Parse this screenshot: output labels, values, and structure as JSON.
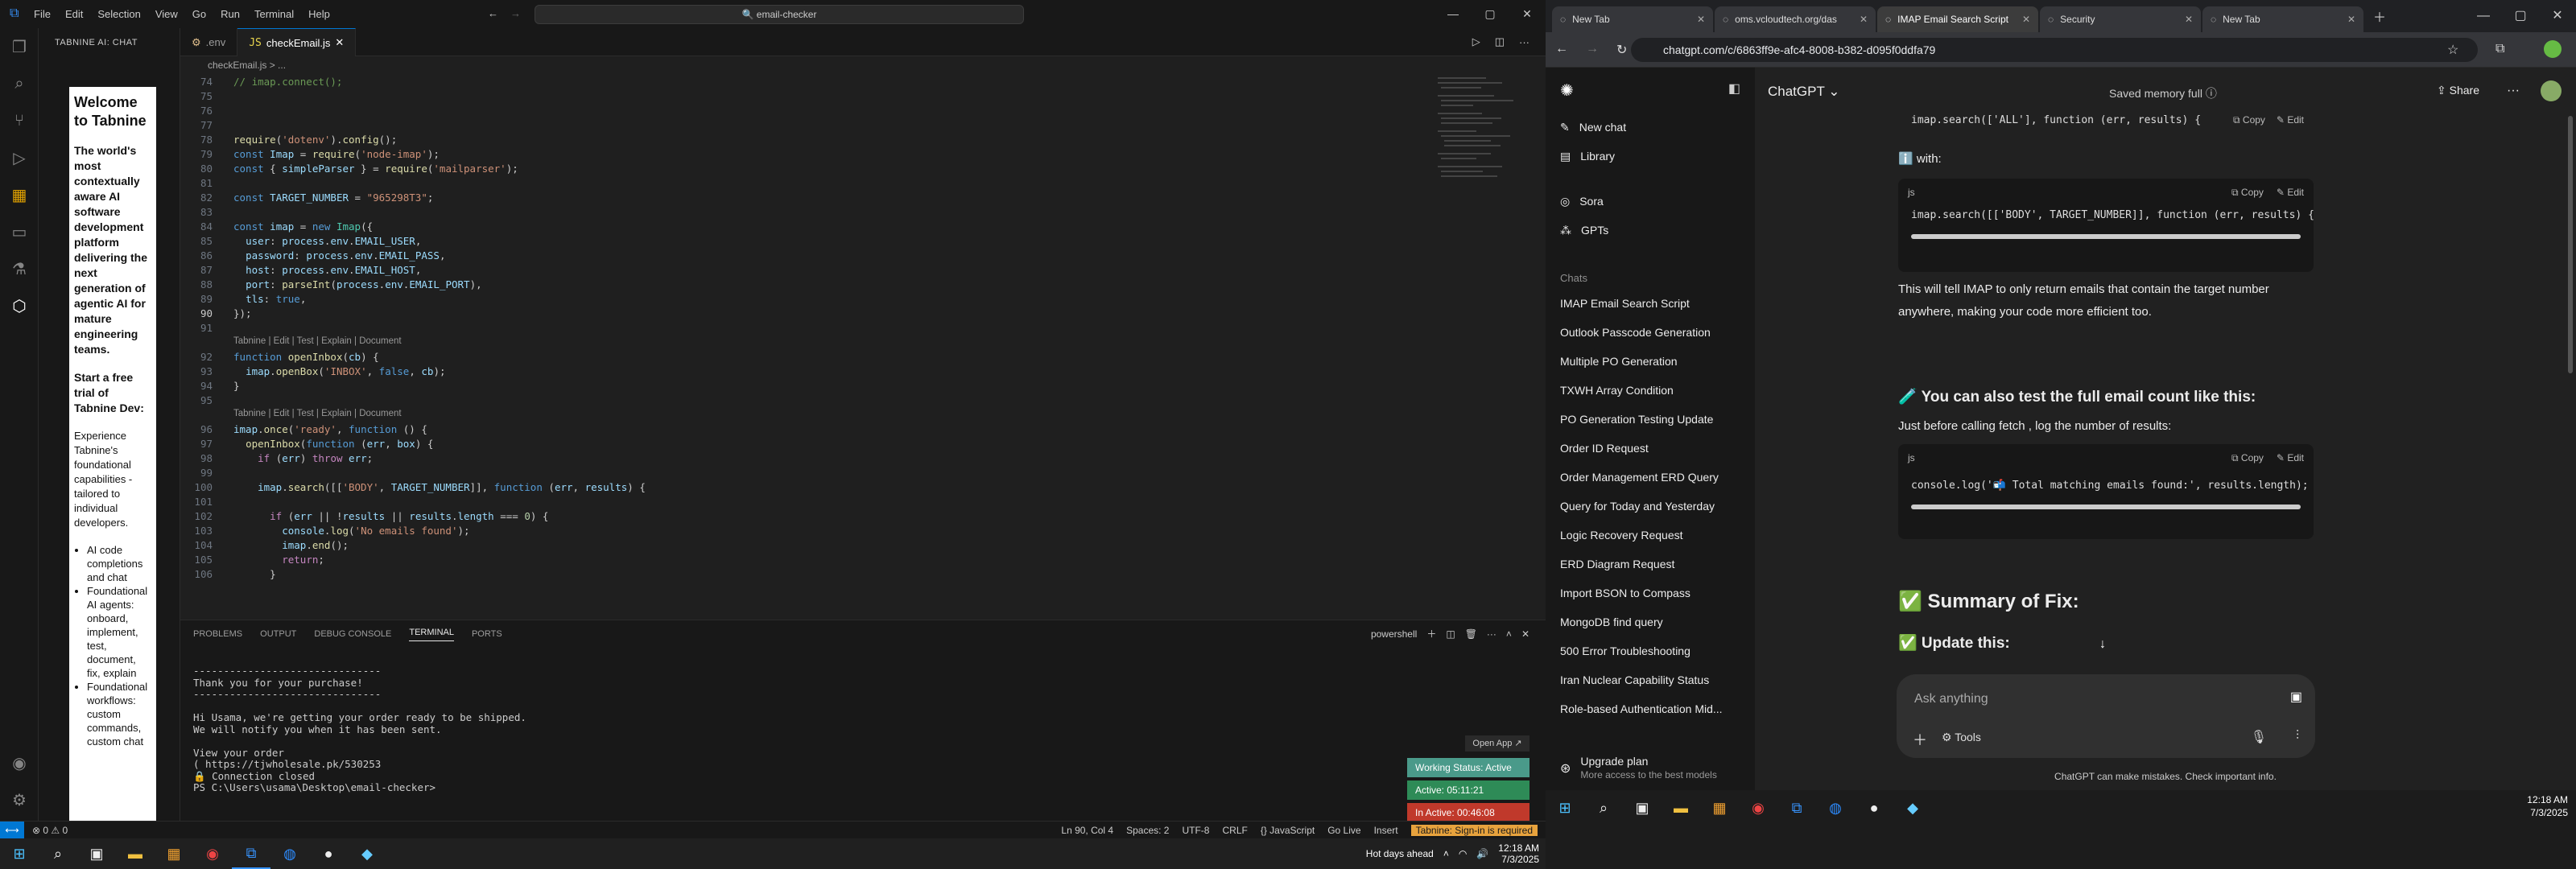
{
  "vscode": {
    "menu": [
      "File",
      "Edit",
      "Selection",
      "View",
      "Go",
      "Run",
      "Terminal",
      "Help"
    ],
    "search": "email-checker",
    "sidebar_title": "TABNINE AI: CHAT",
    "tabnine": {
      "welcome": "Welcome to Tabnine",
      "tagline": "The world's most contextually aware AI software development platform delivering the next generation of agentic AI for mature engineering teams.",
      "trial": "Start a free trial of Tabnine Dev:",
      "experience": "Experience Tabnine's foundational capabilities - tailored to individual developers.",
      "bullets": [
        "AI code completions and chat",
        "Foundational AI agents: onboard, implement, test, document, fix, explain",
        "Foundational workflows: custom commands, custom chat"
      ]
    },
    "tabs": [
      {
        "label": ".env"
      },
      {
        "label": "checkEmail.js"
      }
    ],
    "breadcrumb": "checkEmail.js > ...",
    "lens": "Tabnine | Edit | Test | Explain | Document",
    "panel_tabs": [
      "PROBLEMS",
      "OUTPUT",
      "DEBUG CONSOLE",
      "TERMINAL",
      "PORTS"
    ],
    "shell": "powershell",
    "terminal": "-------------------------------\nThank you for your purchase!\n-------------------------------\n\nHi Usama, we're getting your order ready to be shipped.\nWe will notify you when it has been sent.\n\nView your order\n( https://tjwholesale.pk/530253\n🔒 Connection closed\nPS C:\\Users\\usama\\Desktop\\email-checker> ",
    "status_left": "⊗ 0 ⚠ 0",
    "status_right": [
      "Ln 90, Col 4",
      "Spaces: 2",
      "UTF-8",
      "CRLF",
      "{} JavaScript",
      "Go Live",
      "Insert",
      "Tabnine: Sign-in is required"
    ],
    "open_app": "Open App ↗",
    "working_status": "Working Status: Active",
    "active_time": "Active: 05:11:21",
    "inactive_time": "In Active: 00:46:08"
  },
  "taskbar_left": {
    "weather": "Hot days ahead",
    "time": "12:18 AM",
    "date": "7/3/2025"
  },
  "chrome": {
    "tabs": [
      "New Tab",
      "oms.vcloudtech.org/das",
      "IMAP Email Search Script",
      "Security",
      "New Tab"
    ],
    "url": "chatgpt.com/c/6863ff9e-afc4-8008-b382-d095f0ddfa79"
  },
  "chatgpt": {
    "sidebar_items": [
      "New chat",
      "Library",
      "Sora",
      "GPTs"
    ],
    "chats_label": "Chats",
    "chats": [
      "IMAP Email Search Script",
      "Outlook Passcode Generation",
      "Multiple PO Generation",
      "TXWH Array Condition",
      "PO Generation Testing Update",
      "Order ID Request",
      "Order Management ERD Query",
      "Query for Today and Yesterday",
      "Logic Recovery Request",
      "ERD Diagram Request",
      "Import BSON to Compass",
      "MongoDB find query",
      "500 Error Troubleshooting",
      "Iran Nuclear Capability Status",
      "Role-based Authentication Mid..."
    ],
    "upgrade": "Upgrade plan",
    "upgrade_sub": "More access to the best models",
    "model": "ChatGPT",
    "memory": "Saved memory full",
    "share": "Share",
    "code1": "imap.search(['ALL'], function (err, results) {",
    "with": "with:",
    "lang": "js",
    "copy": "Copy",
    "edit": "Edit",
    "code2": "imap.search([['BODY', TARGET_NUMBER]], function (err, results) {",
    "para1": "This will tell IMAP to only return emails that contain the target number anywhere, making your code more efficient too.",
    "heading": "🧪 You can also test the full email count like this:",
    "para2": "Just before calling fetch , log the number of results:",
    "code3": "console.log('📬 Total matching emails found:', results.length);",
    "summary": "✅ Summary of Fix:",
    "update": "✅ Update this:",
    "placeholder": "Ask anything",
    "tools": "Tools",
    "disclaimer": "ChatGPT can make mistakes. Check important info.",
    "time": "12:18 AM",
    "date": "7/3/2025"
  }
}
